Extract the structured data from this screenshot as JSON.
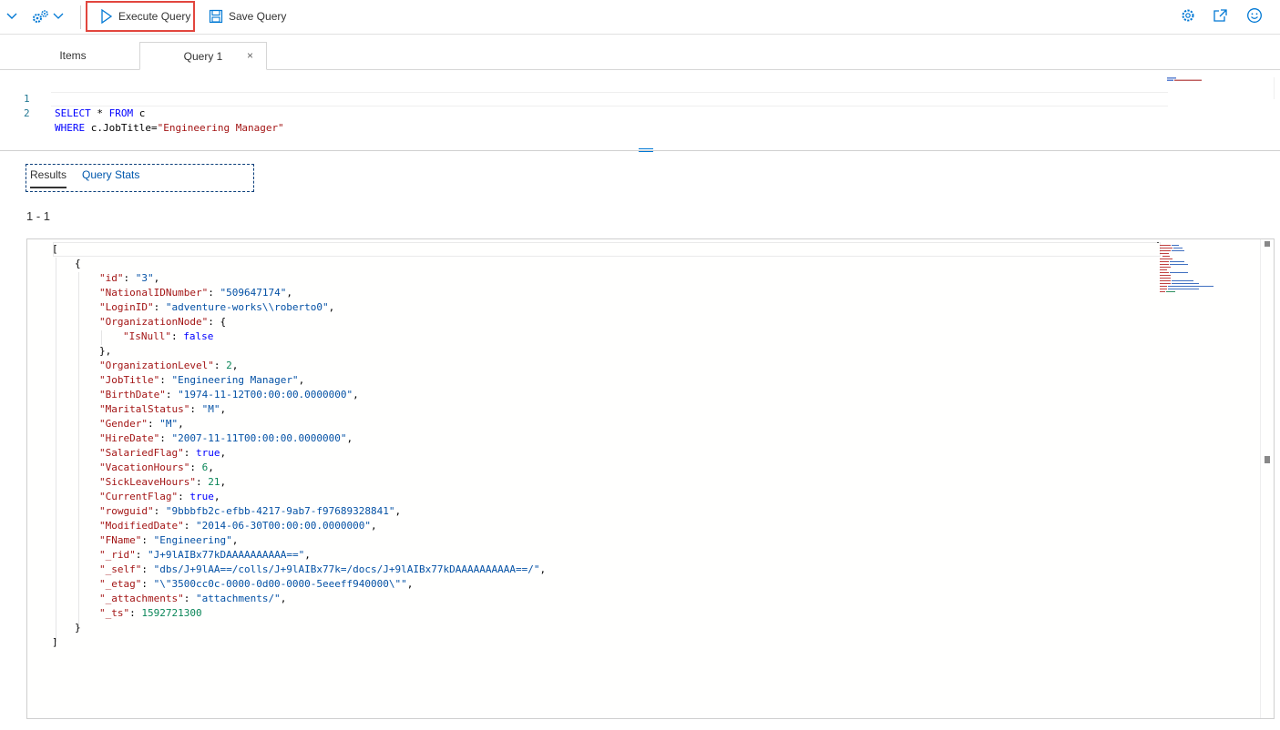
{
  "toolbar": {
    "execute_label": "Execute Query",
    "save_label": "Save Query",
    "icons": [
      "chevron-down-icon",
      "gear-cluster-icon",
      "play-icon",
      "save-icon",
      "settings-icon",
      "open-external-icon",
      "feedback-smiley-icon"
    ],
    "accent": "#0078d4",
    "highlight_color": "#e2463e"
  },
  "tabs": [
    {
      "label": "Items",
      "active": false
    },
    {
      "label": "Query 1",
      "active": true,
      "close": "×"
    }
  ],
  "editor": {
    "lines": [
      {
        "num": "1",
        "kw": "SELECT",
        "rest": " * ",
        "kw2": "FROM",
        "rest2": " c"
      },
      {
        "num": "2",
        "kw": "WHERE",
        "rest": " c.JobTitle=",
        "str": "\"Engineering Manager\""
      }
    ]
  },
  "results": {
    "tabs": [
      "Results",
      "Query Stats"
    ],
    "count": "1 - 1",
    "json": {
      "open_bracket": "[",
      "open_brace": "{",
      "close_brace": "}",
      "close_bracket": "]",
      "nested_key": "\"OrganizationNode\"",
      "nested_inner_key": "\"IsNull\"",
      "nested_inner_val": "false",
      "nested_close": "},",
      "fields": [
        {
          "k": "\"id\"",
          "v": "\"3\"",
          "t": "s",
          "c": ","
        },
        {
          "k": "\"NationalIDNumber\"",
          "v": "\"509647174\"",
          "t": "s",
          "c": ","
        },
        {
          "k": "\"LoginID\"",
          "v": "\"adventure-works\\\\roberto0\"",
          "t": "s",
          "c": ","
        }
      ],
      "fields2": [
        {
          "k": "\"OrganizationLevel\"",
          "v": "2",
          "t": "n",
          "c": ","
        },
        {
          "k": "\"JobTitle\"",
          "v": "\"Engineering Manager\"",
          "t": "s",
          "c": ","
        },
        {
          "k": "\"BirthDate\"",
          "v": "\"1974-11-12T00:00:00.0000000\"",
          "t": "s",
          "c": ","
        },
        {
          "k": "\"MaritalStatus\"",
          "v": "\"M\"",
          "t": "s",
          "c": ","
        },
        {
          "k": "\"Gender\"",
          "v": "\"M\"",
          "t": "s",
          "c": ","
        },
        {
          "k": "\"HireDate\"",
          "v": "\"2007-11-11T00:00:00.0000000\"",
          "t": "s",
          "c": ","
        },
        {
          "k": "\"SalariedFlag\"",
          "v": "true",
          "t": "b",
          "c": ","
        },
        {
          "k": "\"VacationHours\"",
          "v": "6",
          "t": "n",
          "c": ","
        },
        {
          "k": "\"SickLeaveHours\"",
          "v": "21",
          "t": "n",
          "c": ","
        },
        {
          "k": "\"CurrentFlag\"",
          "v": "true",
          "t": "b",
          "c": ","
        },
        {
          "k": "\"rowguid\"",
          "v": "\"9bbbfb2c-efbb-4217-9ab7-f97689328841\"",
          "t": "s",
          "c": ","
        },
        {
          "k": "\"ModifiedDate\"",
          "v": "\"2014-06-30T00:00:00.0000000\"",
          "t": "s",
          "c": ","
        },
        {
          "k": "\"FName\"",
          "v": "\"Engineering\"",
          "t": "s",
          "c": ","
        },
        {
          "k": "\"_rid\"",
          "v": "\"J+9lAIBx77kDAAAAAAAAAA==\"",
          "t": "s",
          "c": ","
        },
        {
          "k": "\"_self\"",
          "v": "\"dbs/J+9lAA==/colls/J+9lAIBx77k=/docs/J+9lAIBx77kDAAAAAAAAAA==/\"",
          "t": "s",
          "c": ","
        },
        {
          "k": "\"_etag\"",
          "v": "\"\\\"3500cc0c-0000-0d00-0000-5eeeff940000\\\"\"",
          "t": "s",
          "c": ","
        },
        {
          "k": "\"_attachments\"",
          "v": "\"attachments/\"",
          "t": "s",
          "c": ","
        },
        {
          "k": "\"_ts\"",
          "v": "1592721300",
          "t": "n",
          "c": ""
        }
      ]
    }
  }
}
